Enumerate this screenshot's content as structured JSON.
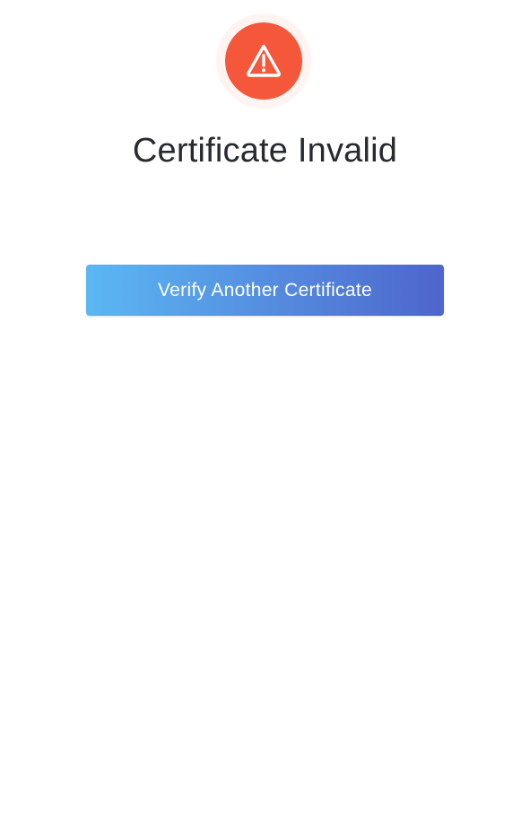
{
  "result": {
    "status_icon": "warning-triangle-icon",
    "status_color": "#f5573a",
    "title": "Certificate Invalid"
  },
  "actions": {
    "verify_another_label": "Verify Another Certificate",
    "button_gradient_start": "#5bb7f3",
    "button_gradient_end": "#4e65cc"
  }
}
